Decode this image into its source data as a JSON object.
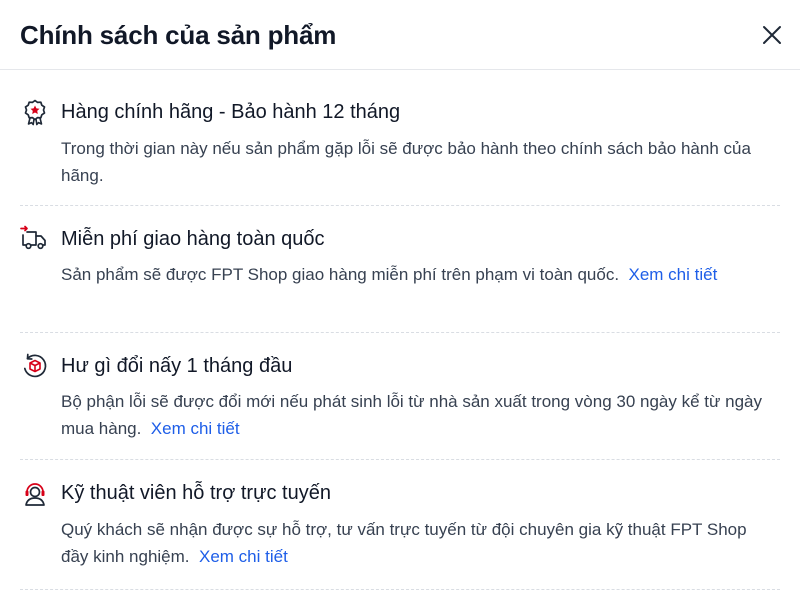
{
  "modal": {
    "title": "Chính sách của sản phẩm",
    "close_icon": "close-icon"
  },
  "policies": [
    {
      "icon": "badge-star-icon",
      "title": "Hàng chính hãng - Bảo hành 12 tháng",
      "description": "Trong thời gian này nếu sản phẩm gặp lỗi sẽ được bảo hành theo chính sách bảo hành của hãng.",
      "link": ""
    },
    {
      "icon": "delivery-truck-icon",
      "title": "Miễn phí giao hàng toàn quốc",
      "description": "Sản phẩm sẽ được FPT Shop giao hàng miễn phí trên phạm vi toàn quốc.",
      "link": "Xem chi tiết"
    },
    {
      "icon": "return-box-icon",
      "title": "Hư gì đổi nấy 1 tháng đầu",
      "description": "Bộ phận lỗi sẽ được đổi mới nếu phát sinh lỗi từ nhà sản xuất trong vòng 30 ngày kể từ ngày mua hàng.",
      "link": "Xem chi tiết"
    },
    {
      "icon": "support-agent-icon",
      "title": "Kỹ thuật viên hỗ trợ trực tuyến",
      "description": "Quý khách sẽ nhận được sự hỗ trợ, tư vấn trực tuyến từ đội chuyên gia kỹ thuật FPT Shop đầy kinh nghiệm.",
      "link": "Xem chi tiết"
    }
  ],
  "colors": {
    "link": "#1e5ee8",
    "accent": "#d70018",
    "text": "#111827"
  }
}
